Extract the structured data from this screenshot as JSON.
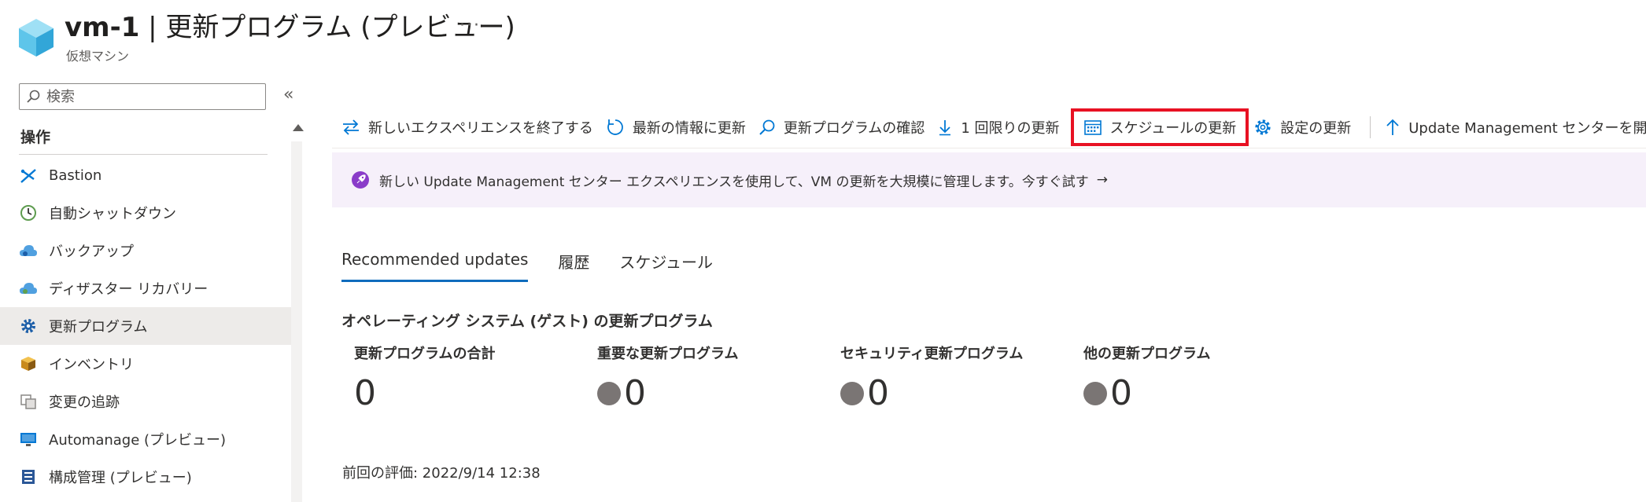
{
  "header": {
    "vm_name": "vm-1",
    "title_rest": " | 更新プログラム (プレビュー)",
    "more": "···",
    "subtitle": "仮想マシン"
  },
  "sidebar": {
    "search_placeholder": "検索",
    "collapse": "«",
    "section": "操作",
    "items": [
      {
        "label": "Bastion",
        "icon": "bastion-icon"
      },
      {
        "label": "自動シャットダウン",
        "icon": "clock-icon"
      },
      {
        "label": "バックアップ",
        "icon": "backup-cloud-icon"
      },
      {
        "label": "ディザスター リカバリー",
        "icon": "disaster-recovery-icon"
      },
      {
        "label": "更新プログラム",
        "icon": "gear-icon",
        "selected": true
      },
      {
        "label": "インベントリ",
        "icon": "inventory-box-icon"
      },
      {
        "label": "変更の追跡",
        "icon": "change-tracking-icon"
      },
      {
        "label": "Automanage (プレビュー)",
        "icon": "automanage-monitor-icon"
      },
      {
        "label": "構成管理 (プレビュー)",
        "icon": "configuration-list-icon"
      }
    ]
  },
  "toolbar": {
    "exit_experience": "新しいエクスペリエンスを終了する",
    "refresh": "最新の情報に更新",
    "check_updates": "更新プログラムの確認",
    "one_time_update": "1 回限りの更新",
    "schedule_update": "スケジュールの更新",
    "settings_update": "設定の更新",
    "open_center": "Update Management センターを開く"
  },
  "banner": {
    "text": "新しい Update Management センター エクスペリエンスを使用して、VM の更新を大規模に管理します。今すぐ試す",
    "arrow": "→"
  },
  "tabs": [
    "Recommended updates",
    "履歴",
    "スケジュール"
  ],
  "os_section_title": "オペレーティング システム (ゲスト) の更新プログラム",
  "metrics": [
    {
      "label": "更新プログラムの合計",
      "value": "0",
      "dot": false
    },
    {
      "label": "重要な更新プログラム",
      "value": "0",
      "dot": true
    },
    {
      "label": "セキュリティ更新プログラム",
      "value": "0",
      "dot": true
    },
    {
      "label": "他の更新プログラム",
      "value": "0",
      "dot": true
    }
  ],
  "last_evaluation": "前回の評価: 2022/9/14 12:38",
  "colors": {
    "accent": "#0f6cbd",
    "highlight": "#e81123",
    "banner_bg": "#f6f0fa",
    "selected_bg": "#edebe9",
    "dot": "#7a7574"
  }
}
